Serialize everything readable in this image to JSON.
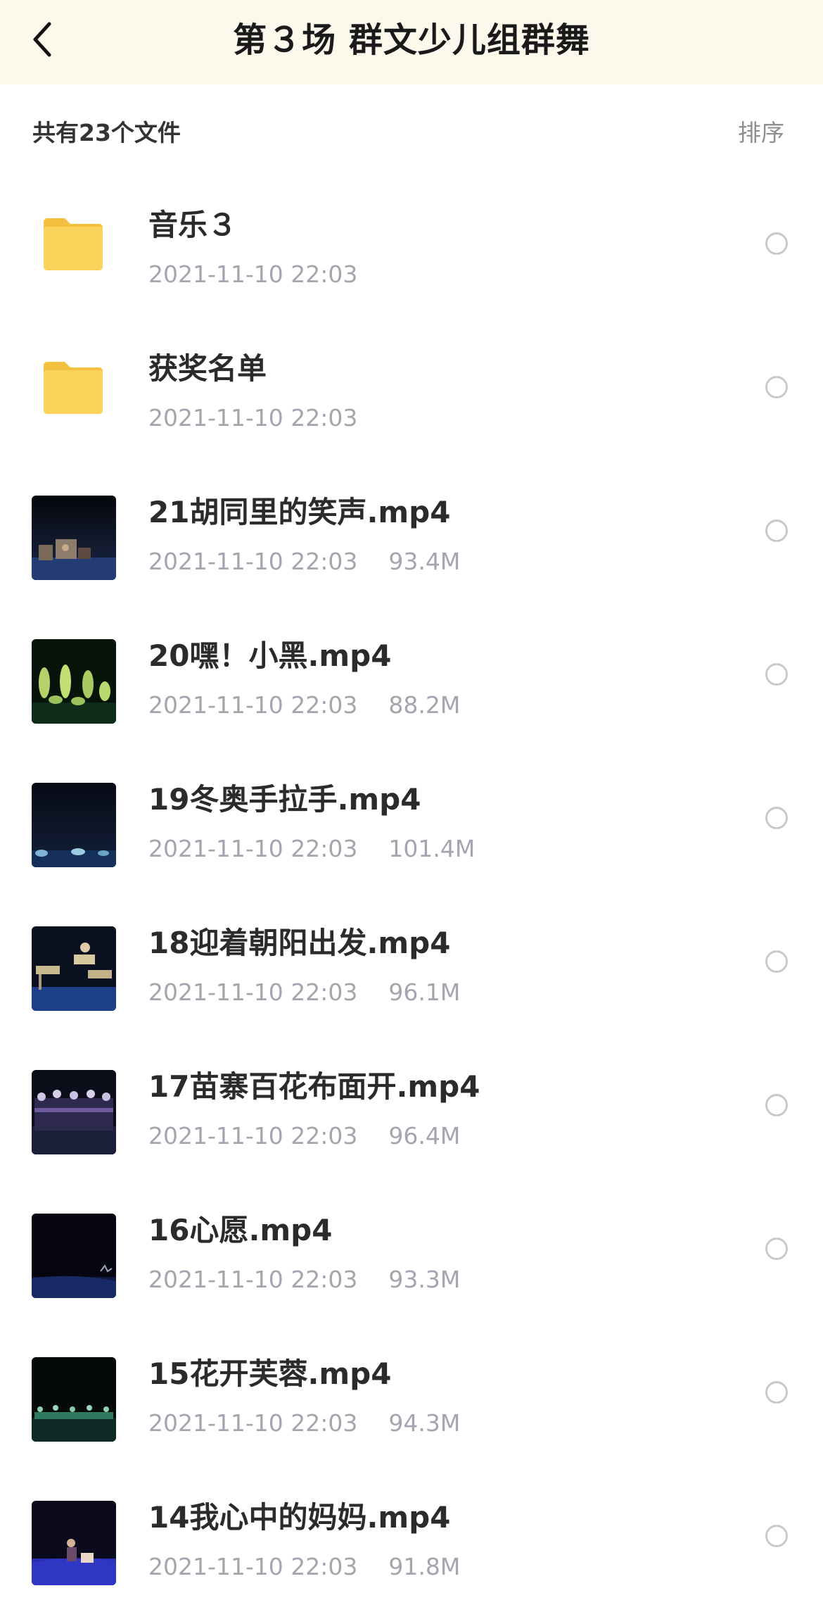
{
  "header": {
    "title": "第３场 群文少儿组群舞"
  },
  "subbar": {
    "count": "共有23个文件",
    "sort_label": "排序"
  },
  "icons": {
    "back": "chevron-left-icon",
    "folder": "folder-icon",
    "radio": "radio-circle-icon"
  },
  "colors": {
    "header_bg": "#fcf8ec",
    "folder": "#f9cd4e",
    "meta": "#a3a6ae"
  },
  "files": [
    {
      "type": "folder",
      "name": "音乐３",
      "date": "2021-11-10 22:03",
      "size": ""
    },
    {
      "type": "folder",
      "name": "获奖名单",
      "date": "2021-11-10 22:03",
      "size": ""
    },
    {
      "type": "video",
      "name": "21胡同里的笑声.mp4",
      "date": "2021-11-10 22:03",
      "size": "93.4M"
    },
    {
      "type": "video",
      "name": "20嘿！小黑.mp4",
      "date": "2021-11-10 22:03",
      "size": "88.2M"
    },
    {
      "type": "video",
      "name": "19冬奥手拉手.mp4",
      "date": "2021-11-10 22:03",
      "size": "101.4M"
    },
    {
      "type": "video",
      "name": "18迎着朝阳出发.mp4",
      "date": "2021-11-10 22:03",
      "size": "96.1M"
    },
    {
      "type": "video",
      "name": "17苗寨百花布面开.mp4",
      "date": "2021-11-10 22:03",
      "size": "96.4M"
    },
    {
      "type": "video",
      "name": "16心愿.mp4",
      "date": "2021-11-10 22:03",
      "size": "93.3M"
    },
    {
      "type": "video",
      "name": "15花开芙蓉.mp4",
      "date": "2021-11-10 22:03",
      "size": "94.3M"
    },
    {
      "type": "video",
      "name": "14我心中的妈妈.mp4",
      "date": "2021-11-10 22:03",
      "size": "91.8M"
    }
  ]
}
